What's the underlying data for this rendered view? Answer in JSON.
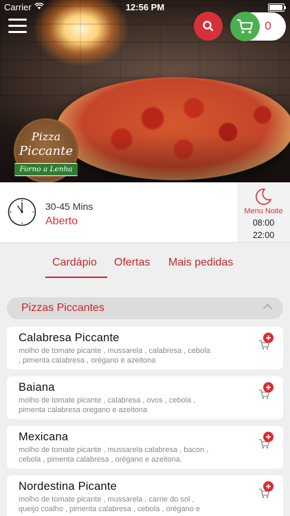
{
  "status_bar": {
    "carrier": "Carrier",
    "time": "12:56 PM"
  },
  "header": {
    "cart_count": "0",
    "logo": {
      "line1": "Pizza",
      "line2": "Piccante",
      "banner": "Forno a Lenha"
    }
  },
  "info": {
    "delivery_time": "30-45 Mins",
    "open_status": "Aberto",
    "menu_night": {
      "title": "Menu Noite",
      "open": "08:00",
      "close": "22:00"
    }
  },
  "tabs": [
    {
      "label": "Cardápio",
      "active": true
    },
    {
      "label": "Ofertas",
      "active": false
    },
    {
      "label": "Mais pedidas",
      "active": false
    }
  ],
  "category": {
    "title": "Pizzas Piccantes",
    "expanded": true
  },
  "items": [
    {
      "name": "Calabresa Piccante",
      "desc_line1": "molho de tomate picante , mussarela , calabresa , cebola",
      "desc_line2": ", pimenta calabresa , orégano e azeitona"
    },
    {
      "name": "Baiana",
      "desc_line1": "molho de tomate picante , calabresa , ovos , cebola ,",
      "desc_line2": "pimenta calabresa oregano e azeitona"
    },
    {
      "name": "Mexicana",
      "desc_line1": "molho de tomate picante , mussarela calabresa , bacon ,",
      "desc_line2": "cebola , pimenta calabresa , orégano e azeitona."
    },
    {
      "name": "Nordestina Picante",
      "desc_line1": "molho de tomate picante , mussarela , carne do sol ,",
      "desc_line2": "queijo coalho , pimenta calabresa , cebola , orégano e"
    }
  ],
  "colors": {
    "accent": "#c8262c",
    "search": "#d8303a",
    "cart": "#4caf50",
    "background": "#efefef"
  },
  "icons": [
    "menu-icon",
    "search-icon",
    "cart-icon",
    "clock-icon",
    "moon-icon",
    "chevron-up-icon",
    "add-to-cart-icon"
  ]
}
